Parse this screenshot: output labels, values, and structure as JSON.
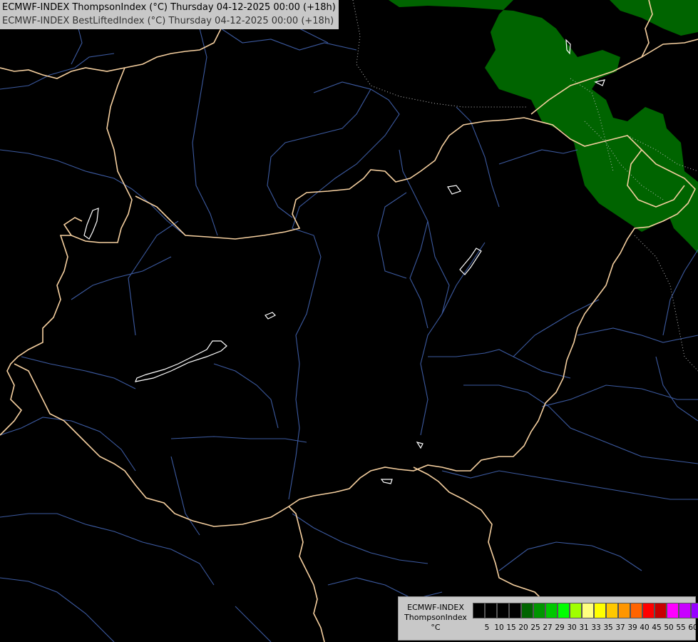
{
  "header": {
    "line1": "ECMWF-INDEX ThompsonIndex (°C) Thursday 04-12-2025 00:00 (+18h)",
    "line2": "ECMWF-INDEX BestLiftedIndex (°C) Thursday 04-12-2025 00:00 (+18h)"
  },
  "legend": {
    "model": "ECMWF-INDEX",
    "parameter": "ThompsonIndex",
    "unit": "°C",
    "ticks": [
      "5",
      "10",
      "15",
      "20",
      "25",
      "27",
      "29",
      "30",
      "31",
      "33",
      "35",
      "37",
      "39",
      "40",
      "45",
      "50",
      "55",
      "60"
    ],
    "colors": [
      "#000000",
      "#000000",
      "#000000",
      "#000000",
      "#006400",
      "#009600",
      "#00c800",
      "#00ff00",
      "#a0ff00",
      "#ffff80",
      "#ffff00",
      "#ffc800",
      "#ff9600",
      "#ff6400",
      "#ff0000",
      "#c80000",
      "#ff00ff",
      "#c800ff",
      "#9600ff",
      "#0000ff"
    ]
  },
  "map": {
    "ocean_color": "#000000",
    "border_color": "#f5cf9f",
    "river_color": "#3c5aa0",
    "lake_color": "#ffffff",
    "index_zone_color": "#006400"
  }
}
